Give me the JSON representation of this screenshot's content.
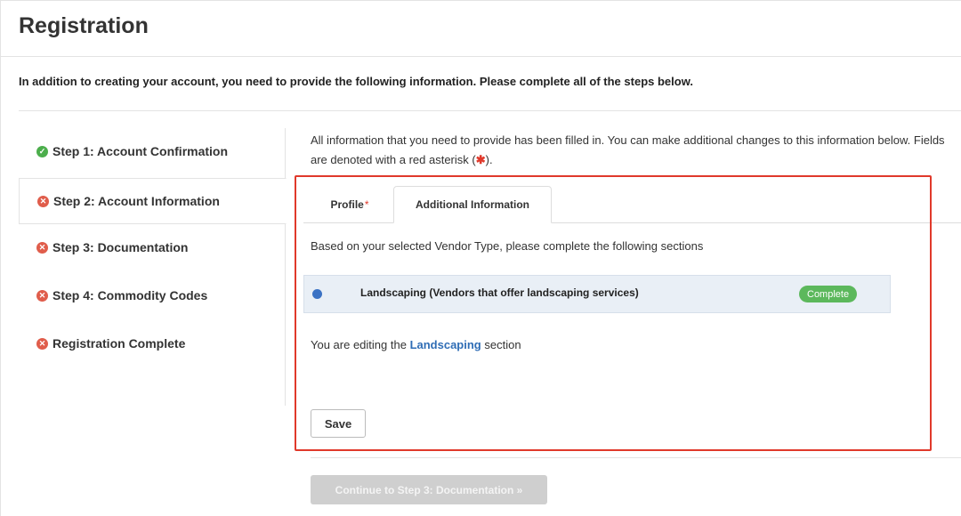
{
  "page": {
    "title": "Registration",
    "intro": "In addition to creating your account, you need to provide the following information. Please complete all of the steps below."
  },
  "steps": [
    {
      "label": "Step 1: Account Confirmation",
      "status": "complete",
      "icon": "check-circle-icon"
    },
    {
      "label": "Step 2: Account Information",
      "status": "incomplete",
      "icon": "x-circle-icon",
      "active": true
    },
    {
      "label": "Step 3: Documentation",
      "status": "incomplete",
      "icon": "x-circle-icon"
    },
    {
      "label": "Step 4: Commodity Codes",
      "status": "incomplete",
      "icon": "x-circle-icon"
    },
    {
      "label": "Registration Complete",
      "status": "incomplete",
      "icon": "x-circle-icon"
    }
  ],
  "main": {
    "info_text_1": "All information that you need to provide has been filled in. You can make additional changes to this information below. Fields",
    "info_text_2_prefix": "are denoted with a red asterisk (",
    "info_text_asterisk": "✱",
    "info_text_2_suffix": ").",
    "tabs": [
      {
        "label": "Profile",
        "required_mark": "*"
      },
      {
        "label": "Additional Information",
        "active": true
      }
    ],
    "sections_intro": "Based on your selected Vendor Type, please complete the following sections",
    "section": {
      "label": "Landscaping (Vendors that offer landscaping services)",
      "status": "Complete"
    },
    "editing_prefix": "You are editing the ",
    "editing_link": "Landscaping",
    "editing_suffix": " section",
    "save_label": "Save",
    "continue_label": "Continue to Step 3: Documentation »"
  },
  "colors": {
    "complete_badge": "#5cb85c",
    "link": "#2f6db5",
    "required": "#e0392b",
    "highlight_box": "#e0392b",
    "section_dot": "#3b72c4"
  }
}
